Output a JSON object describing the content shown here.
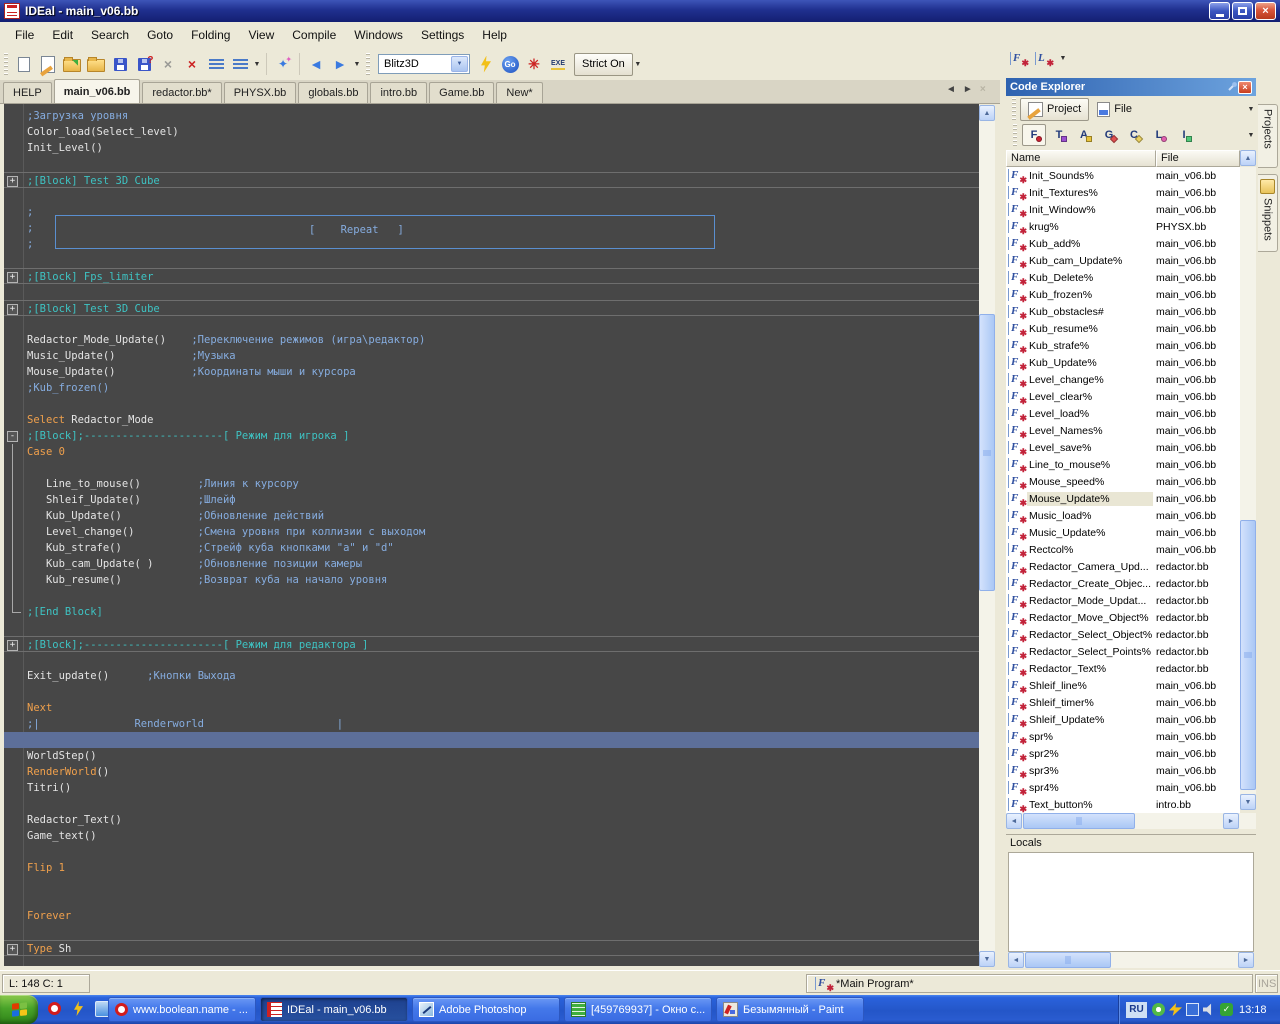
{
  "window": {
    "title": "IDEal - main_v06.bb"
  },
  "menu_bar": {
    "items": [
      "File",
      "Edit",
      "Search",
      "Goto",
      "Folding",
      "View",
      "Compile",
      "Windows",
      "Settings",
      "Help"
    ]
  },
  "toolbar": {
    "compiler": "Blitz3D",
    "strict_button": "Strict On",
    "go_button": "Go",
    "exe_label": "EXE"
  },
  "doc_tabs": {
    "tabs": [
      {
        "label": "HELP",
        "active": false
      },
      {
        "label": "main_v06.bb",
        "active": true
      },
      {
        "label": "redactor.bb*",
        "active": false
      },
      {
        "label": "PHYSX.bb",
        "active": false
      },
      {
        "label": "globals.bb",
        "active": false
      },
      {
        "label": "intro.bb",
        "active": false
      },
      {
        "label": "Game.bb",
        "active": false
      },
      {
        "label": "New*",
        "active": false
      }
    ]
  },
  "editor": {
    "colors": {
      "background": "#474747",
      "comment": "#86ade0",
      "keyword": "#f0a04c",
      "code": "#e4e4e4",
      "block": "#3ec3c3",
      "current_line": "#5d6f99"
    },
    "repeat_box_label": "[    Repeat   ]",
    "lines": [
      {
        "segs": [
          [
            "c",
            ";Загрузка уровня"
          ]
        ]
      },
      {
        "segs": [
          [
            "w",
            "Color_load(Select_level)"
          ]
        ]
      },
      {
        "segs": [
          [
            "w",
            "Init_Level()"
          ]
        ]
      },
      {
        "segs": []
      },
      {
        "fold": "plus",
        "sep": true,
        "segs": [
          [
            "b",
            ";[Block] Test 3D Cube"
          ]
        ]
      },
      {
        "segs": []
      },
      {
        "segs": [
          [
            "c",
            ";"
          ]
        ]
      },
      {
        "segs": [
          [
            "c",
            ";"
          ]
        ]
      },
      {
        "segs": [
          [
            "c",
            ";"
          ]
        ]
      },
      {
        "segs": []
      },
      {
        "fold": "plus",
        "sep": true,
        "segs": [
          [
            "b",
            ";[Block] Fps_limiter"
          ]
        ]
      },
      {
        "segs": []
      },
      {
        "fold": "plus",
        "sep": true,
        "segs": [
          [
            "b",
            ";[Block] Test 3D Cube"
          ]
        ]
      },
      {
        "segs": []
      },
      {
        "segs": [
          [
            "w",
            "Redactor_Mode_Update()"
          ],
          [
            "c",
            "    ;Переключение режимов (игра\\редактор)"
          ]
        ]
      },
      {
        "segs": [
          [
            "w",
            "Music_Update()"
          ],
          [
            "c",
            "            ;Музыка"
          ]
        ]
      },
      {
        "segs": [
          [
            "w",
            "Mouse_Update()"
          ],
          [
            "c",
            "            ;Координаты мыши и курсора"
          ]
        ]
      },
      {
        "segs": [
          [
            "c",
            ";Kub_frozen()"
          ]
        ]
      },
      {
        "segs": []
      },
      {
        "segs": [
          [
            "k",
            "Select"
          ],
          [
            "w",
            " Redactor_Mode"
          ]
        ]
      },
      {
        "fold": "minus",
        "segs": [
          [
            "b",
            ";[Block];----------------------[ Режим для игрока ]"
          ]
        ]
      },
      {
        "bracket": true,
        "segs": [
          [
            "k",
            "Case 0"
          ]
        ]
      },
      {
        "bracket": true,
        "segs": []
      },
      {
        "bracket": true,
        "segs": [
          [
            "w",
            "   Line_to_mouse()"
          ],
          [
            "c",
            "         ;Линия к курсору"
          ]
        ]
      },
      {
        "bracket": true,
        "segs": [
          [
            "w",
            "   Shleif_Update()"
          ],
          [
            "c",
            "         ;Шлейф"
          ]
        ]
      },
      {
        "bracket": true,
        "segs": [
          [
            "w",
            "   Kub_Update()"
          ],
          [
            "c",
            "            ;Обновление действий"
          ]
        ]
      },
      {
        "bracket": true,
        "segs": [
          [
            "w",
            "   Level_change()"
          ],
          [
            "c",
            "          ;Смена уровня при коллизии с выходом"
          ]
        ]
      },
      {
        "bracket": true,
        "segs": [
          [
            "w",
            "   Kub_strafe()"
          ],
          [
            "c",
            "            ;Стрейф куба кнопками \"a\" и \"d\""
          ]
        ]
      },
      {
        "bracket": true,
        "segs": [
          [
            "w",
            "   Kub_cam_Update( )"
          ],
          [
            "c",
            "       ;Обновление позиции камеры"
          ]
        ]
      },
      {
        "bracket": true,
        "segs": [
          [
            "w",
            "   Kub_resume()"
          ],
          [
            "c",
            "            ;Возврат куба на начало уровня"
          ]
        ]
      },
      {
        "bracket": true,
        "segs": []
      },
      {
        "fold": "end",
        "segs": [
          [
            "b",
            ";[End Block]"
          ]
        ]
      },
      {
        "segs": []
      },
      {
        "fold": "plus",
        "sep": true,
        "segs": [
          [
            "b",
            ";[Block];----------------------[ Режим для редактора ]"
          ]
        ]
      },
      {
        "segs": []
      },
      {
        "segs": [
          [
            "w",
            "Exit_update()"
          ],
          [
            "c",
            "      ;Кнопки Выхода"
          ]
        ]
      },
      {
        "segs": []
      },
      {
        "segs": [
          [
            "k",
            "Next"
          ]
        ]
      },
      {
        "segs": [
          [
            "c",
            ";|               Renderworld                     |"
          ]
        ]
      },
      {
        "hl": true,
        "segs": []
      },
      {
        "segs": [
          [
            "w",
            "WorldStep()"
          ]
        ]
      },
      {
        "segs": [
          [
            "k",
            "RenderWorld"
          ],
          [
            "w",
            "()"
          ]
        ]
      },
      {
        "segs": [
          [
            "w",
            "Titri()"
          ]
        ]
      },
      {
        "segs": []
      },
      {
        "segs": [
          [
            "w",
            "Redactor_Text()"
          ]
        ]
      },
      {
        "segs": [
          [
            "w",
            "Game_text()"
          ]
        ]
      },
      {
        "segs": []
      },
      {
        "segs": [
          [
            "k",
            "Flip 1"
          ]
        ]
      },
      {
        "segs": []
      },
      {
        "segs": []
      },
      {
        "segs": [
          [
            "k",
            "Forever"
          ]
        ]
      },
      {
        "segs": []
      },
      {
        "fold": "plus",
        "sep": true,
        "segs": [
          [
            "k",
            "Type"
          ],
          [
            "w",
            " Sh"
          ]
        ]
      }
    ]
  },
  "code_explorer": {
    "title": "Code Explorer",
    "tabs": [
      {
        "label": "Project",
        "active": true
      },
      {
        "label": "File",
        "active": false
      }
    ],
    "filters": [
      {
        "name": "functions-filter-icon",
        "letter": "F",
        "accent": "#cc2233",
        "shape": "circle",
        "active": true
      },
      {
        "name": "types-filter-icon",
        "letter": "T",
        "accent": "#9b4fd0",
        "shape": "square",
        "active": false
      },
      {
        "name": "arrays-filter-icon",
        "letter": "A",
        "accent": "#e8c33a",
        "shape": "square",
        "active": false
      },
      {
        "name": "globals-filter-icon",
        "letter": "G",
        "accent": "#e05050",
        "shape": "diamond",
        "active": false
      },
      {
        "name": "consts-filter-icon",
        "letter": "C",
        "accent": "#ead060",
        "shape": "diamond",
        "active": false
      },
      {
        "name": "labels-filter-icon",
        "letter": "L",
        "accent": "#e060b0",
        "shape": "circle",
        "active": false
      },
      {
        "name": "includes-filter-icon",
        "letter": "I",
        "accent": "#50c878",
        "shape": "square",
        "active": false
      }
    ],
    "columns": [
      "Name",
      "File"
    ],
    "items": [
      {
        "name": "Init_Sounds%",
        "file": "main_v06.bb"
      },
      {
        "name": "Init_Textures%",
        "file": "main_v06.bb"
      },
      {
        "name": "Init_Window%",
        "file": "main_v06.bb"
      },
      {
        "name": "krug%",
        "file": "PHYSX.bb"
      },
      {
        "name": "Kub_add%",
        "file": "main_v06.bb"
      },
      {
        "name": "Kub_cam_Update%",
        "file": "main_v06.bb"
      },
      {
        "name": "Kub_Delete%",
        "file": "main_v06.bb"
      },
      {
        "name": "Kub_frozen%",
        "file": "main_v06.bb"
      },
      {
        "name": "Kub_obstacles#",
        "file": "main_v06.bb"
      },
      {
        "name": "Kub_resume%",
        "file": "main_v06.bb"
      },
      {
        "name": "Kub_strafe%",
        "file": "main_v06.bb"
      },
      {
        "name": "Kub_Update%",
        "file": "main_v06.bb"
      },
      {
        "name": "Level_change%",
        "file": "main_v06.bb"
      },
      {
        "name": "Level_clear%",
        "file": "main_v06.bb"
      },
      {
        "name": "Level_load%",
        "file": "main_v06.bb"
      },
      {
        "name": "Level_Names%",
        "file": "main_v06.bb"
      },
      {
        "name": "Level_save%",
        "file": "main_v06.bb"
      },
      {
        "name": "Line_to_mouse%",
        "file": "main_v06.bb"
      },
      {
        "name": "Mouse_speed%",
        "file": "main_v06.bb"
      },
      {
        "name": "Mouse_Update%",
        "file": "main_v06.bb",
        "selected": true
      },
      {
        "name": "Music_load%",
        "file": "main_v06.bb"
      },
      {
        "name": "Music_Update%",
        "file": "main_v06.bb"
      },
      {
        "name": "Rectcol%",
        "file": "main_v06.bb"
      },
      {
        "name": "Redactor_Camera_Upd...",
        "file": "redactor.bb"
      },
      {
        "name": "Redactor_Create_Objec...",
        "file": "redactor.bb"
      },
      {
        "name": "Redactor_Mode_Updat...",
        "file": "redactor.bb"
      },
      {
        "name": "Redactor_Move_Object%",
        "file": "redactor.bb"
      },
      {
        "name": "Redactor_Select_Object%",
        "file": "redactor.bb"
      },
      {
        "name": "Redactor_Select_Points%",
        "file": "redactor.bb"
      },
      {
        "name": "Redactor_Text%",
        "file": "redactor.bb"
      },
      {
        "name": "Shleif_line%",
        "file": "main_v06.bb"
      },
      {
        "name": "Shleif_timer%",
        "file": "main_v06.bb"
      },
      {
        "name": "Shleif_Update%",
        "file": "main_v06.bb"
      },
      {
        "name": "spr%",
        "file": "main_v06.bb"
      },
      {
        "name": "spr2%",
        "file": "main_v06.bb"
      },
      {
        "name": "spr3%",
        "file": "main_v06.bb"
      },
      {
        "name": "spr4%",
        "file": "main_v06.bb"
      },
      {
        "name": "Text_button%",
        "file": "intro.bb"
      }
    ]
  },
  "locals_panel": {
    "title": "Locals"
  },
  "side_tabs": [
    {
      "label": "Projects",
      "icon": ""
    },
    {
      "label": "Snippets",
      "icon": "snippets-icon"
    }
  ],
  "status_bar": {
    "line_col": "L: 148 C: 1",
    "program": "*Main Program*",
    "ins": "INS"
  },
  "taskbar": {
    "quick_launch": [
      "opera-icon",
      "winamp-icon",
      "mail-icon"
    ],
    "tasks": [
      {
        "label": "www.boolean.name - ...",
        "icon": "opera-icon",
        "active": false
      },
      {
        "label": "IDEal - main_v06.bb",
        "icon": "ideal-icon",
        "active": true
      },
      {
        "label": "Adobe Photoshop",
        "icon": "photoshop-icon",
        "active": false
      },
      {
        "label": "[459769937] - Окно с...",
        "icon": "icq-icon",
        "active": false
      },
      {
        "label": "Безымянный - Paint",
        "icon": "paint-icon",
        "active": false
      }
    ],
    "tray": {
      "lang": "RU",
      "time": "13:18",
      "icons": [
        "icq-flower-icon",
        "winamp-icon",
        "display-icon",
        "volume-icon",
        "antivirus-icon"
      ]
    }
  }
}
